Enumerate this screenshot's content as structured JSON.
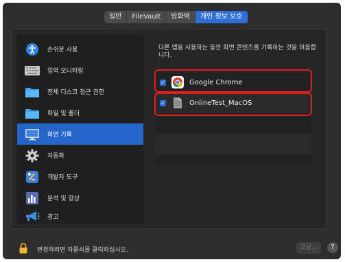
{
  "tabs": [
    {
      "label": "일반"
    },
    {
      "label": "FileVault"
    },
    {
      "label": "방화벽"
    },
    {
      "label": "개인 정보 보호"
    }
  ],
  "sidebar": {
    "items": [
      {
        "label": "손쉬운 사용",
        "icon": "accessibility-icon"
      },
      {
        "label": "입력 모니터링",
        "icon": "keyboard-icon"
      },
      {
        "label": "전체 디스크 접근 권한",
        "icon": "folder-icon"
      },
      {
        "label": "파일 및 폴더",
        "icon": "folder-icon"
      },
      {
        "label": "화면 기록",
        "icon": "display-icon"
      },
      {
        "label": "자동화",
        "icon": "gear-icon"
      },
      {
        "label": "개발자 도구",
        "icon": "developer-tools-icon"
      },
      {
        "label": "분석 및 향상",
        "icon": "chart-icon"
      },
      {
        "label": "광고",
        "icon": "megaphone-icon"
      }
    ],
    "selected": "화면 기록"
  },
  "content": {
    "description": "다른 앱을 사용하는 동안 화면 콘텐츠를 기록하는 것을 허용합니다.",
    "apps": [
      {
        "name": "Google Chrome",
        "icon": "chrome-icon",
        "checked": true
      },
      {
        "name": "OnlineTest_MacOS",
        "icon": "app-file-icon",
        "checked": true
      }
    ]
  },
  "footer": {
    "lock_text": "변경하려면 자물쇠를 클릭하십시오.",
    "advanced_label": "고급...",
    "help_label": "?"
  },
  "colors": {
    "accent": "#2d6ed9",
    "highlight": "#e11d1d"
  }
}
